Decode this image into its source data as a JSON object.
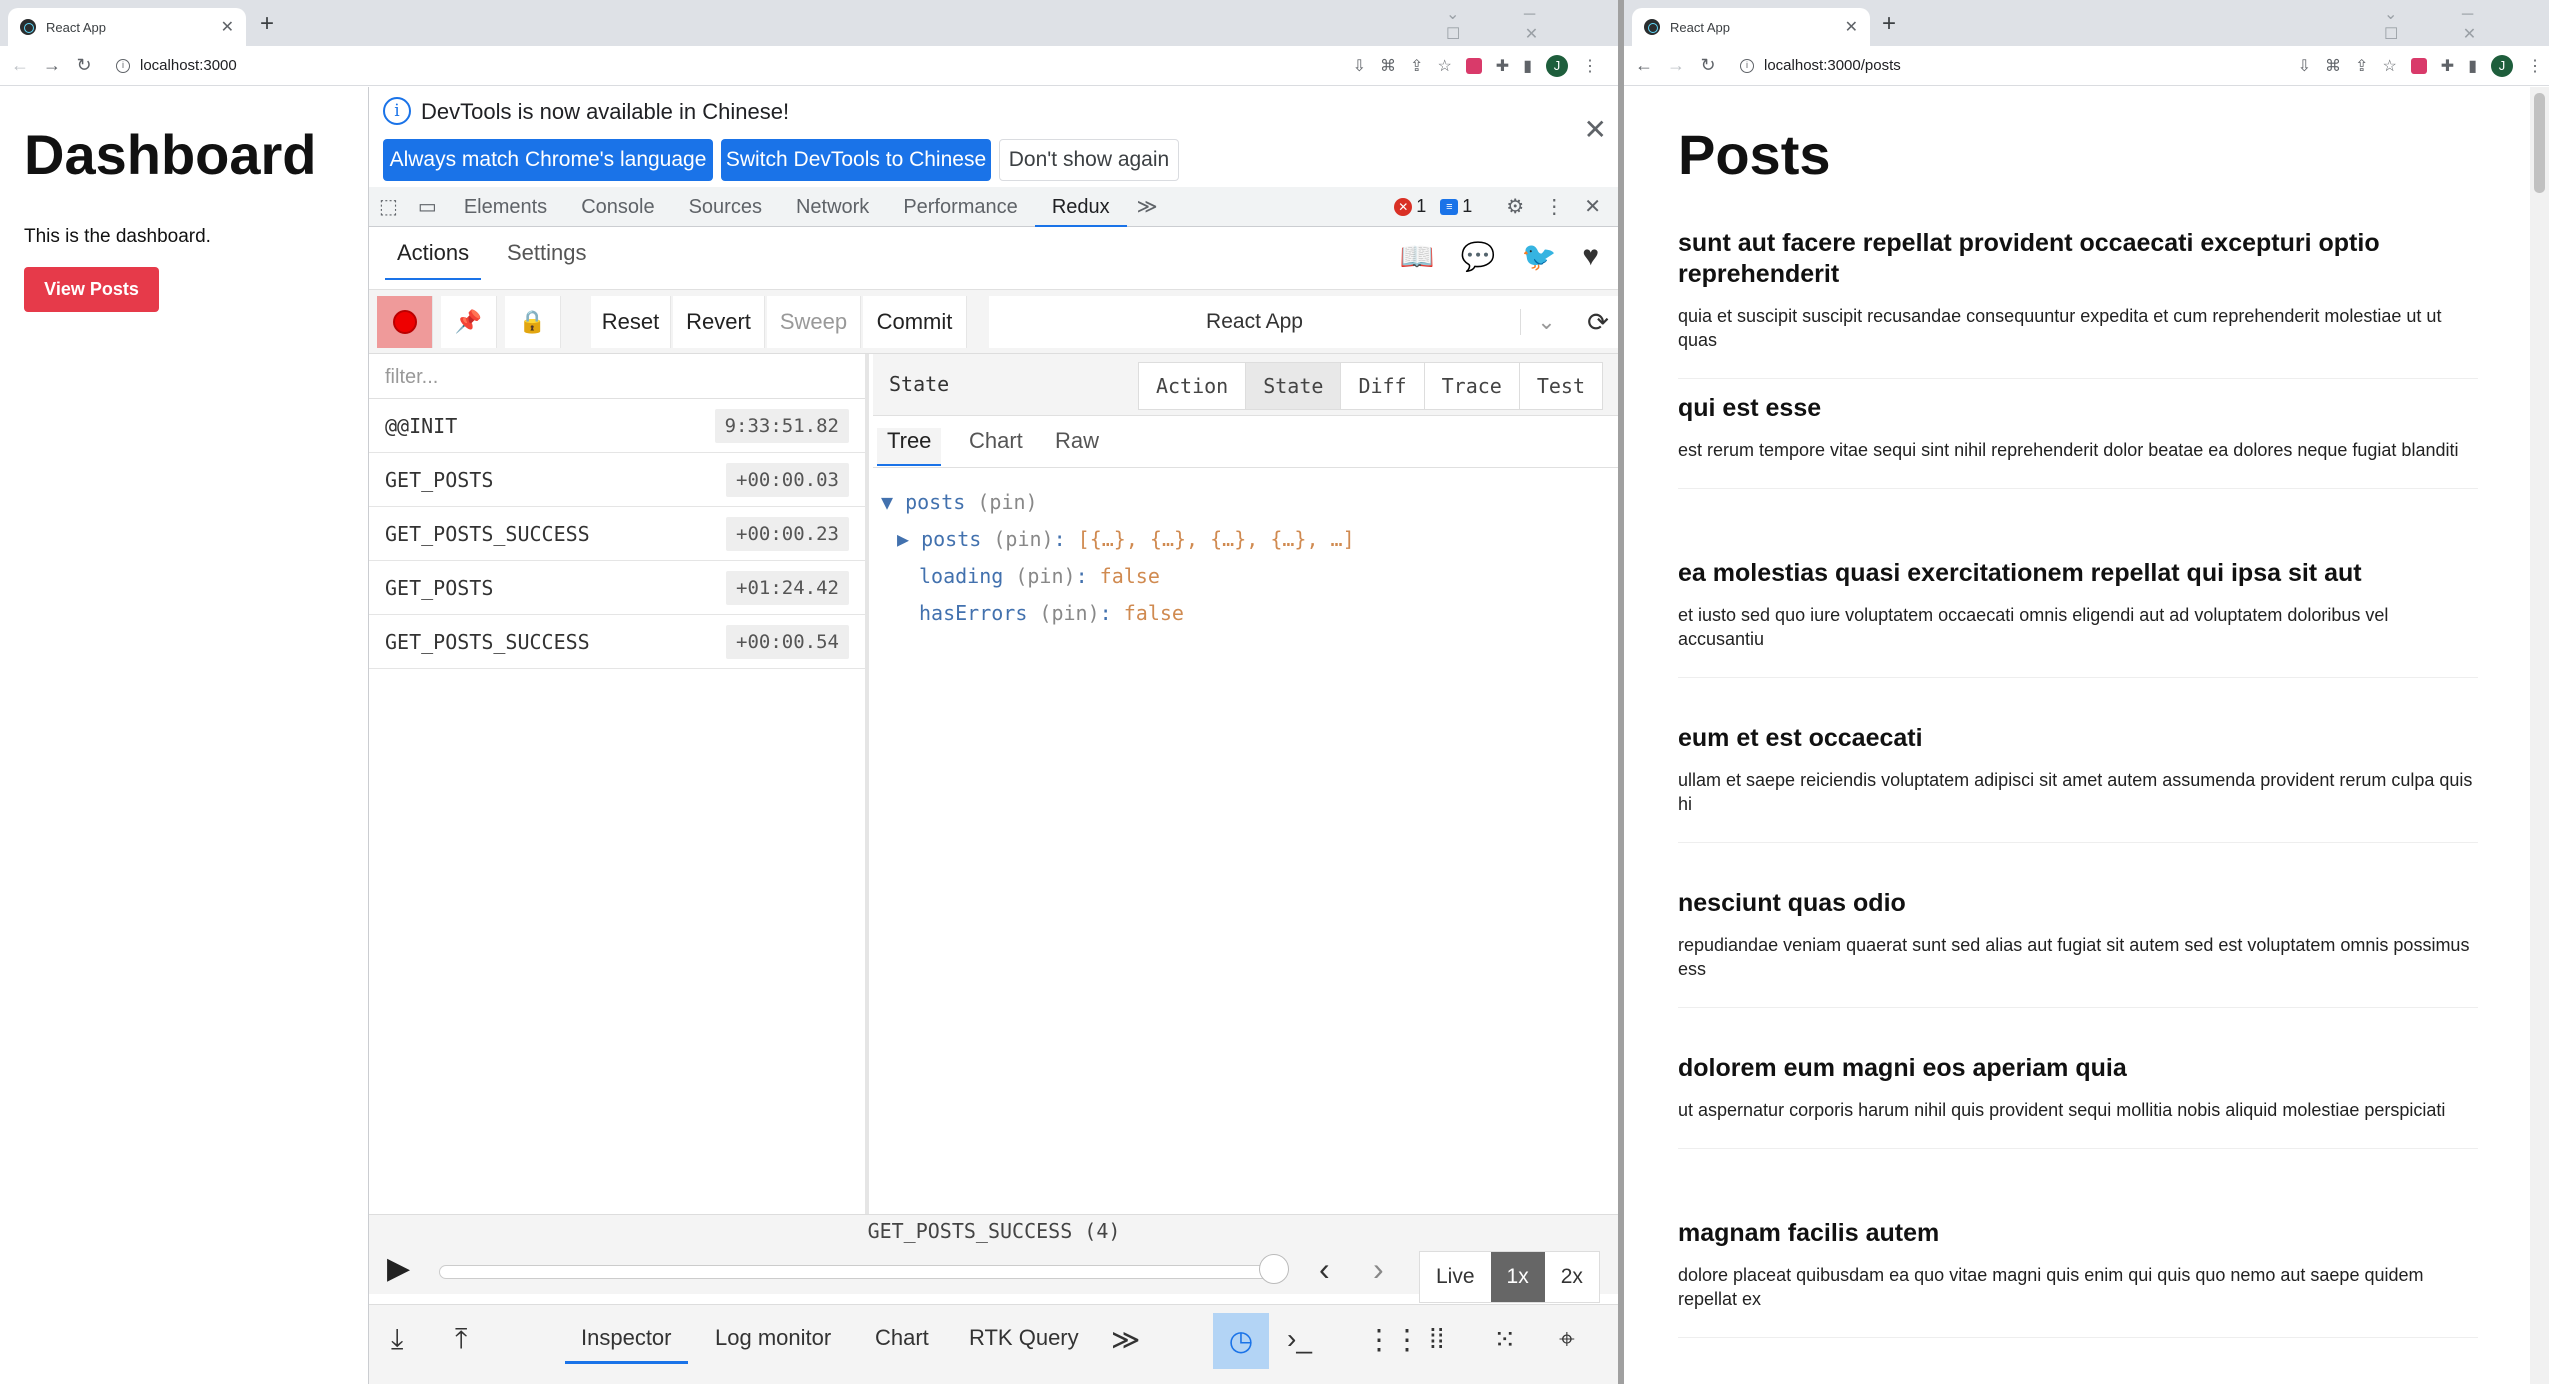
{
  "left_window": {
    "tab_title": "React App",
    "url": "localhost:3000",
    "dashboard_title": "Dashboard",
    "dashboard_text": "This is the dashboard.",
    "view_posts_label": "View Posts"
  },
  "devtools": {
    "info_text": "DevTools is now available in Chinese!",
    "btn_match": "Always match Chrome's language",
    "btn_switch": "Switch DevTools to Chinese",
    "btn_dont_show": "Don't show again",
    "tabs": [
      "Elements",
      "Console",
      "Sources",
      "Network",
      "Performance",
      "Redux"
    ],
    "error_count": "1",
    "message_count": "1"
  },
  "redux": {
    "top_tabs": [
      "Actions",
      "Settings"
    ],
    "controls": {
      "reset": "Reset",
      "revert": "Revert",
      "sweep": "Sweep",
      "commit": "Commit"
    },
    "instance": "React App",
    "filter_placeholder": "filter...",
    "actions": [
      {
        "name": "@@INIT",
        "time": "9:33:51.82"
      },
      {
        "name": "GET_POSTS",
        "time": "+00:00.03"
      },
      {
        "name": "GET_POSTS_SUCCESS",
        "time": "+00:00.23"
      },
      {
        "name": "GET_POSTS",
        "time": "+01:24.42"
      },
      {
        "name": "GET_POSTS_SUCCESS",
        "time": "+00:00.54"
      }
    ],
    "detail_label": "State",
    "detail_tabs": [
      "Action",
      "State",
      "Diff",
      "Trace",
      "Test"
    ],
    "sub_tabs": [
      "Tree",
      "Chart",
      "Raw"
    ],
    "tree": {
      "root_key": "posts",
      "pin": "(pin)",
      "posts_key": "posts",
      "posts_value": "[{…}, {…}, {…}, {…}, …]",
      "loading_key": "loading",
      "loading_value": "false",
      "errors_key": "hasErrors",
      "errors_value": "false"
    },
    "slider_label": "GET_POSTS_SUCCESS (4)",
    "slider_position": 1.0,
    "speeds": [
      "Live",
      "1x",
      "2x"
    ],
    "bottom_tabs": [
      "Inspector",
      "Log monitor",
      "Chart",
      "RTK Query"
    ]
  },
  "right_window": {
    "tab_title": "React App",
    "url": "localhost:3000/posts",
    "posts_title": "Posts",
    "posts": [
      {
        "title": "sunt aut facere repellat provident occaecati excepturi optio reprehenderit",
        "body": "quia et suscipit suscipit recusandae consequuntur expedita et cum reprehenderit molestiae ut ut quas"
      },
      {
        "title": "qui est esse",
        "body": "est rerum tempore vitae sequi sint nihil reprehenderit dolor beatae ea dolores neque fugiat blanditi"
      },
      {
        "title": "ea molestias quasi exercitationem repellat qui ipsa sit aut",
        "body": "et iusto sed quo iure voluptatem occaecati omnis eligendi aut ad voluptatem doloribus vel accusantiu"
      },
      {
        "title": "eum et est occaecati",
        "body": "ullam et saepe reiciendis voluptatem adipisci sit amet autem assumenda provident rerum culpa quis hi"
      },
      {
        "title": "nesciunt quas odio",
        "body": "repudiandae veniam quaerat sunt sed alias aut fugiat sit autem sed est voluptatem omnis possimus ess"
      },
      {
        "title": "dolorem eum magni eos aperiam quia",
        "body": "ut aspernatur corporis harum nihil quis provident sequi mollitia nobis aliquid molestiae perspiciati"
      },
      {
        "title": "magnam facilis autem",
        "body": "dolore placeat quibusdam ea quo vitae magni quis enim qui quis quo nemo aut saepe quidem repellat ex"
      }
    ]
  },
  "colors": {
    "accent": "#1a73e8",
    "view_posts_button": "#e63a4a"
  }
}
